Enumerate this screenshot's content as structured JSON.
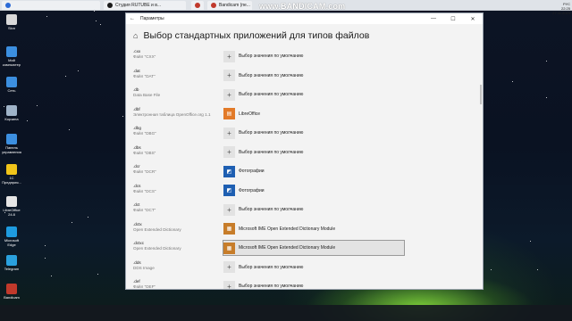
{
  "browser": {
    "tabs": [
      {
        "label": "",
        "color": "#2b6ad6"
      },
      {
        "label": "Студия RUTUBE и в...",
        "color": "#1a1a1a"
      },
      {
        "label": "",
        "color": "#c0392b"
      },
      {
        "label": "Bandicam (пе...",
        "color": "#c0392b"
      }
    ],
    "watermark": "www.BANDICAM.com"
  },
  "clock": {
    "time": "22:25",
    "date": "27.11.2023",
    "lang": "РУС"
  },
  "desktop_icons": [
    {
      "label": "Slon",
      "color": "#d9d9d9"
    },
    {
      "label": "Мой компьютер",
      "color": "#3c8fe0"
    },
    {
      "label": "Сеть",
      "color": "#3c8fe0"
    },
    {
      "label": "Корзина",
      "color": "#9fb3c8"
    },
    {
      "label": "Панель управления",
      "color": "#3c8fe0"
    },
    {
      "label": "1С Предприя...",
      "color": "#f0c419"
    },
    {
      "label": "LibreOffice 24.8",
      "color": "#e6e6e6"
    },
    {
      "label": "Microsoft Edge",
      "color": "#1e9be0"
    },
    {
      "label": "Telegram",
      "color": "#2aa1de"
    },
    {
      "label": "Bandicam",
      "color": "#c0392b"
    }
  ],
  "window": {
    "title": "Параметры",
    "heading": "Выбор стандартных приложений для типов файлов",
    "rows": [
      {
        "ext": ".cxx",
        "desc": "Файл \"CXX\"",
        "app": "Выбор значения по умолчанию",
        "icon": "plus"
      },
      {
        "ext": ".dat",
        "desc": "Файл \"DAT\"",
        "app": "Выбор значения по умолчанию",
        "icon": "plus"
      },
      {
        "ext": ".db",
        "desc": "Data Base File",
        "app": "Выбор значения по умолчанию",
        "icon": "plus"
      },
      {
        "ext": ".dbf",
        "desc": "Электронная таблица OpenOffice.org 1.1",
        "app": "LibreOffice",
        "icon": "lo"
      },
      {
        "ext": ".dbg",
        "desc": "Файл \"DBG\"",
        "app": "Выбор значения по умолчанию",
        "icon": "plus"
      },
      {
        "ext": ".dbs",
        "desc": "Файл \"DBS\"",
        "app": "Выбор значения по умолчанию",
        "icon": "plus"
      },
      {
        "ext": ".dcr",
        "desc": "Файл \"DCR\"",
        "app": "Фотографии",
        "icon": "photo"
      },
      {
        "ext": ".dcs",
        "desc": "Файл \"DCS\"",
        "app": "Фотографии",
        "icon": "photo"
      },
      {
        "ext": ".dct",
        "desc": "Файл \"DCT\"",
        "app": "Выбор значения по умолчанию",
        "icon": "plus"
      },
      {
        "ext": ".dctx",
        "desc": "Open Extended Dictionary",
        "app": "Microsoft IME Open Extended Dictionary Module",
        "icon": "ime"
      },
      {
        "ext": ".dctxc",
        "desc": "Open Extended Dictionary",
        "app": "Microsoft IME Open Extended Dictionary Module",
        "icon": "ime",
        "selected": true
      },
      {
        "ext": ".dds",
        "desc": "DDS Image",
        "app": "Выбор значения по умолчанию",
        "icon": "plus"
      },
      {
        "ext": ".def",
        "desc": "Файл \"DEF\"",
        "app": "Выбор значения по умолчанию",
        "icon": "plus"
      }
    ]
  }
}
